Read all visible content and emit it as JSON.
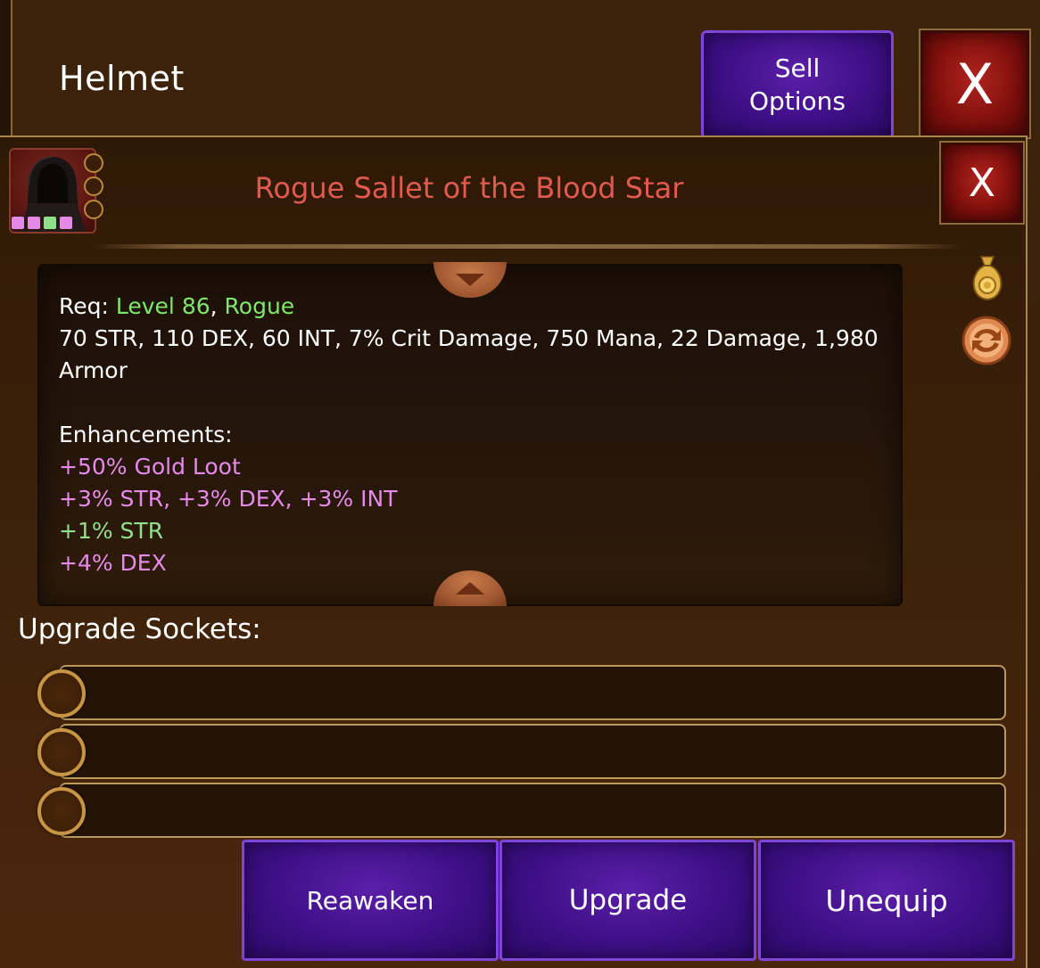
{
  "header": {
    "title": "Helmet",
    "sell_label_line1": "Sell",
    "sell_label_line2": "Options",
    "close_label": "X"
  },
  "item": {
    "name": "Rogue Sallet of the Blood Star",
    "close_label": "X",
    "gem_colors": [
      "#e28ae6",
      "#e28ae6",
      "#8fe08a",
      "#e28ae6"
    ],
    "name_color": "#e15a4f"
  },
  "description": {
    "req_prefix": "Req: ",
    "req_level": "Level 86",
    "req_sep": ", ",
    "req_class": "Rogue",
    "stats": "70 STR, 110 DEX, 60 INT, 7% Crit Damage, 750 Mana, 22 Damage, 1,980 Armor",
    "enhancements_label": "Enhancements:",
    "enhancements": [
      {
        "text": "+50% Gold Loot",
        "color": "pink"
      },
      {
        "text": "+3% STR, +3% DEX, +3% INT",
        "color": "pink"
      },
      {
        "text": "+1% STR",
        "color": "green"
      },
      {
        "text": "+4% DEX",
        "color": "pink"
      }
    ]
  },
  "sockets": {
    "label": "Upgrade Sockets:",
    "count": 3
  },
  "actions": {
    "reawaken": "Reawaken",
    "upgrade": "Upgrade",
    "unequip": "Unequip"
  },
  "icons": {
    "bag": "gold-bag-icon",
    "swap": "swap-icon",
    "portrait": "hooded-rogue-avatar"
  }
}
